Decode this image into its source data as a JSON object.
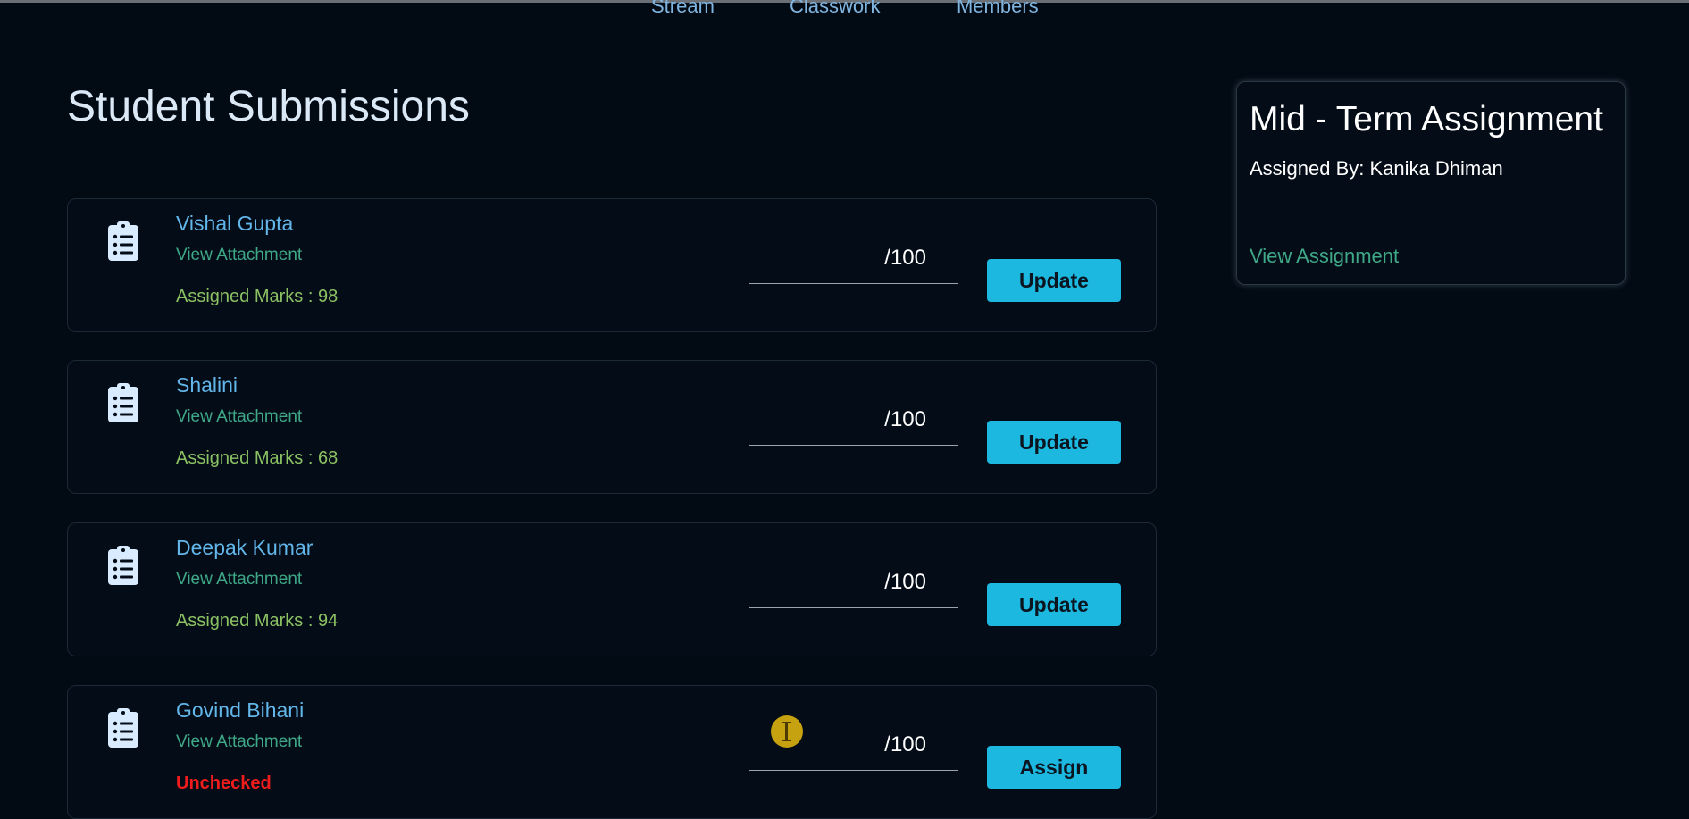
{
  "nav": {
    "tabs": [
      {
        "label": "Stream"
      },
      {
        "label": "Classwork"
      },
      {
        "label": "Members"
      }
    ]
  },
  "page": {
    "title": "Student Submissions"
  },
  "submissions": [
    {
      "student": "Vishal Gupta",
      "attachment_label": "View Attachment",
      "status": "Assigned Marks : 98",
      "marks_value": "",
      "max_marks": "/100",
      "action_label": "Update"
    },
    {
      "student": "Shalini",
      "attachment_label": "View Attachment",
      "status": "Assigned Marks : 68",
      "marks_value": "",
      "max_marks": "/100",
      "action_label": "Update"
    },
    {
      "student": "Deepak Kumar",
      "attachment_label": "View Attachment",
      "status": "Assigned Marks : 94",
      "marks_value": "",
      "max_marks": "/100",
      "action_label": "Update"
    },
    {
      "student": "Govind Bihani",
      "attachment_label": "View Attachment",
      "status": "Unchecked",
      "marks_value": "",
      "max_marks": "/100",
      "action_label": "Assign"
    }
  ],
  "assignment": {
    "title": "Mid - Term Assignment",
    "assigned_by": "Assigned By: Kanika Dhiman",
    "view_label": "View Assignment"
  },
  "icons": {
    "submission_icon": "clipboard-list-icon",
    "cursor": "text-cursor-icon"
  },
  "colors": {
    "background": "#020a14",
    "accent_button": "#1cb8e0",
    "student_name": "#62b6ea",
    "link": "#3fa887",
    "assigned_marks": "#8cc163",
    "unchecked": "#f01c1c"
  }
}
